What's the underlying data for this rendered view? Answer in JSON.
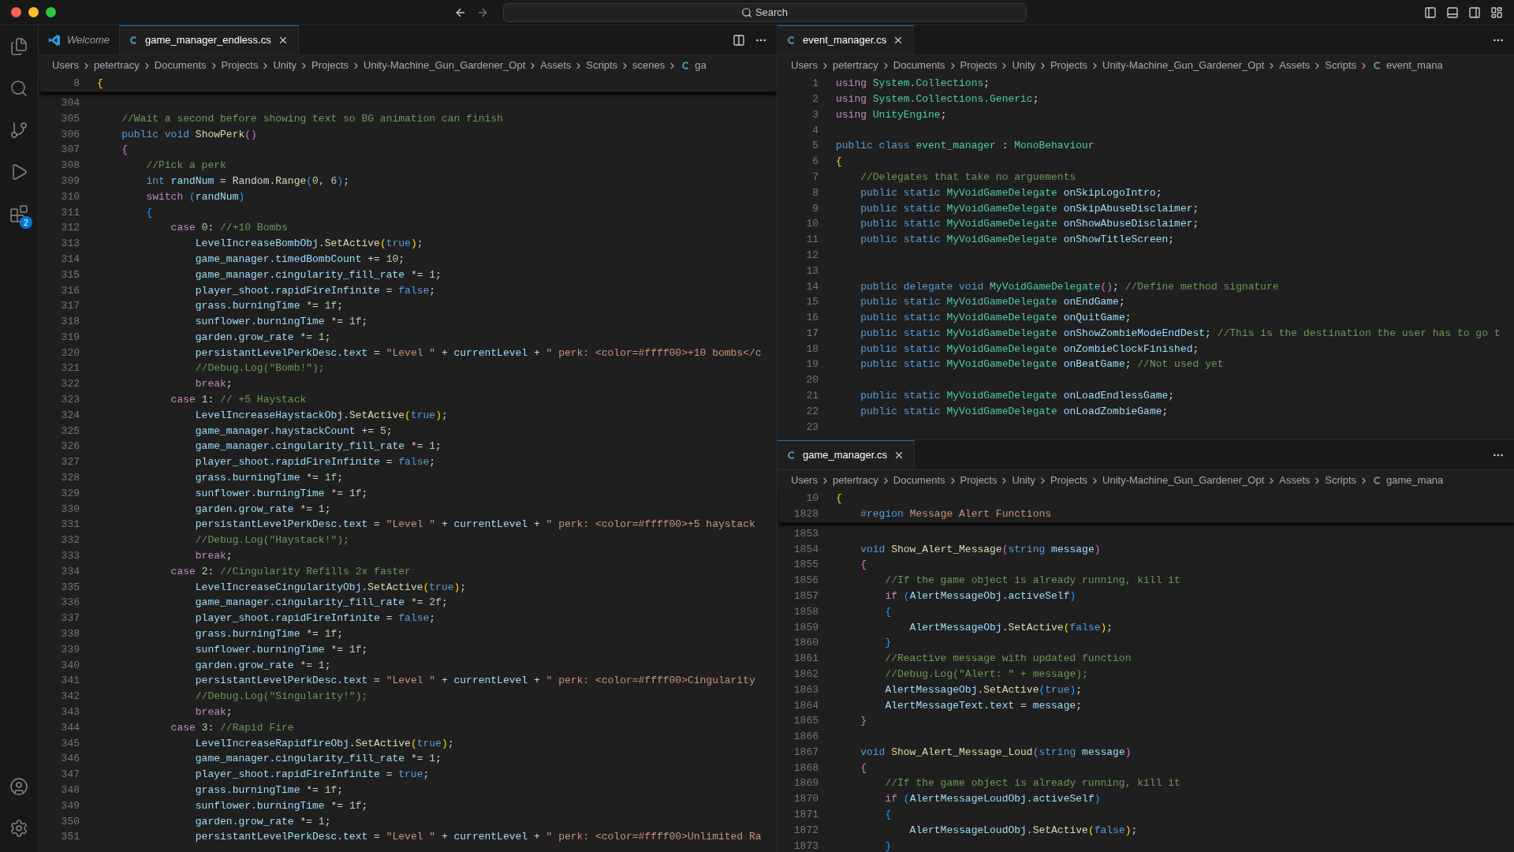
{
  "title_bar": {
    "command_center": {
      "label": "Search"
    }
  },
  "activity_bar": {
    "top": [
      {
        "kind": "files"
      },
      {
        "kind": "search"
      },
      {
        "kind": "source_control"
      },
      {
        "kind": "run"
      },
      {
        "kind": "extensions",
        "badge": "2"
      }
    ],
    "bottom": [
      {
        "kind": "account"
      },
      {
        "kind": "settings"
      }
    ]
  },
  "left_group": {
    "tabs": [
      {
        "label": "Welcome",
        "kind": "welcome",
        "selected": false,
        "preview": true
      },
      {
        "label": "game_manager_endless.cs",
        "kind": "csharp",
        "selected": true,
        "preview": false
      }
    ],
    "breadcrumbs": [
      "Users",
      "petertracy",
      "Documents",
      "Projects",
      "Unity",
      "Projects",
      "Unity-Machine_Gun_Gardener_Opt",
      "Assets",
      "Scripts",
      "scenes"
    ],
    "breadcrumb_file": "ga",
    "sticky_lines": [
      {
        "number": "8",
        "tokens": [
          {
            "kind": "p1",
            "text": "{"
          }
        ]
      }
    ],
    "lines": [
      {
        "number": "304"
      },
      {
        "number": "305",
        "tokens": [
          {
            "kind": "com",
            "text": "    //Wait a second before showing text so BG animation can finish"
          }
        ]
      },
      {
        "number": "306",
        "tokens": [
          {
            "kind": "kw",
            "text": "    public void "
          },
          {
            "kind": "fn",
            "text": "ShowPerk"
          },
          {
            "kind": "p2",
            "text": "()"
          }
        ]
      },
      {
        "number": "307",
        "tokens": [
          {
            "kind": "p2",
            "text": "    {"
          }
        ]
      },
      {
        "number": "308",
        "tokens": [
          {
            "kind": "com",
            "text": "        //Pick a perk"
          }
        ]
      },
      {
        "number": "309",
        "tokens": [
          {
            "kind": "kw",
            "text": "        int "
          },
          {
            "kind": "var",
            "text": "randNum"
          },
          {
            "kind": "txt",
            "text": " = Random."
          },
          {
            "kind": "fn",
            "text": "Range"
          },
          {
            "kind": "p3",
            "text": "("
          },
          {
            "kind": "num",
            "text": "0"
          },
          {
            "kind": "txt",
            "text": ", "
          },
          {
            "kind": "num",
            "text": "6"
          },
          {
            "kind": "p3",
            "text": ")"
          },
          {
            "kind": "txt",
            "text": ";"
          }
        ]
      },
      {
        "number": "310",
        "tokens": [
          {
            "kind": "ctl",
            "text": "        switch "
          },
          {
            "kind": "p3",
            "text": "("
          },
          {
            "kind": "var",
            "text": "randNum"
          },
          {
            "kind": "p3",
            "text": ")"
          }
        ]
      },
      {
        "number": "311",
        "tokens": [
          {
            "kind": "p3",
            "text": "        {"
          }
        ]
      },
      {
        "number": "312",
        "tokens": [
          {
            "kind": "ctl",
            "text": "            case "
          },
          {
            "kind": "num",
            "text": "0"
          },
          {
            "kind": "txt",
            "text": ": "
          },
          {
            "kind": "com",
            "text": "//+10 Bombs"
          }
        ]
      },
      {
        "number": "313",
        "tokens": [
          {
            "kind": "var",
            "text": "                LevelIncreaseBombObj"
          },
          {
            "kind": "txt",
            "text": "."
          },
          {
            "kind": "fn",
            "text": "SetActive"
          },
          {
            "kind": "p1",
            "text": "("
          },
          {
            "kind": "kw",
            "text": "true"
          },
          {
            "kind": "p1",
            "text": ")"
          },
          {
            "kind": "txt",
            "text": ";"
          }
        ]
      },
      {
        "number": "314",
        "tokens": [
          {
            "kind": "var",
            "text": "                game_manager.timedBombCount"
          },
          {
            "kind": "txt",
            "text": " += "
          },
          {
            "kind": "num",
            "text": "10"
          },
          {
            "kind": "txt",
            "text": ";"
          }
        ]
      },
      {
        "number": "315",
        "tokens": [
          {
            "kind": "var",
            "text": "                game_manager.cingularity_fill_rate"
          },
          {
            "kind": "txt",
            "text": " *= "
          },
          {
            "kind": "num",
            "text": "1"
          },
          {
            "kind": "txt",
            "text": ";"
          }
        ]
      },
      {
        "number": "316",
        "tokens": [
          {
            "kind": "var",
            "text": "                player_shoot.rapidFireInfinite"
          },
          {
            "kind": "txt",
            "text": " = "
          },
          {
            "kind": "kw",
            "text": "false"
          },
          {
            "kind": "txt",
            "text": ";"
          }
        ]
      },
      {
        "number": "317",
        "tokens": [
          {
            "kind": "var",
            "text": "                grass.burningTime"
          },
          {
            "kind": "txt",
            "text": " *= "
          },
          {
            "kind": "num",
            "text": "1f"
          },
          {
            "kind": "txt",
            "text": ";"
          }
        ]
      },
      {
        "number": "318",
        "tokens": [
          {
            "kind": "var",
            "text": "                sunflower.burningTime"
          },
          {
            "kind": "txt",
            "text": " *= "
          },
          {
            "kind": "num",
            "text": "1f"
          },
          {
            "kind": "txt",
            "text": ";"
          }
        ]
      },
      {
        "number": "319",
        "tokens": [
          {
            "kind": "var",
            "text": "                garden.grow_rate"
          },
          {
            "kind": "txt",
            "text": " *= "
          },
          {
            "kind": "num",
            "text": "1"
          },
          {
            "kind": "txt",
            "text": ";"
          }
        ]
      },
      {
        "number": "320",
        "tokens": [
          {
            "kind": "var",
            "text": "                persistantLevelPerkDesc.text"
          },
          {
            "kind": "txt",
            "text": " = "
          },
          {
            "kind": "str",
            "text": "\"Level \""
          },
          {
            "kind": "txt",
            "text": " + "
          },
          {
            "kind": "var",
            "text": "currentLevel"
          },
          {
            "kind": "txt",
            "text": " + "
          },
          {
            "kind": "str",
            "text": "\" perk: <color=#ffff00>+10 bombs</c"
          }
        ]
      },
      {
        "number": "321",
        "tokens": [
          {
            "kind": "com",
            "text": "                //Debug.Log(\"Bomb!\");"
          }
        ]
      },
      {
        "number": "322",
        "tokens": [
          {
            "kind": "ctl",
            "text": "                break"
          },
          {
            "kind": "txt",
            "text": ";"
          }
        ]
      },
      {
        "number": "323",
        "tokens": [
          {
            "kind": "ctl",
            "text": "            case "
          },
          {
            "kind": "num",
            "text": "1"
          },
          {
            "kind": "txt",
            "text": ": "
          },
          {
            "kind": "com",
            "text": "// +5 Haystack"
          }
        ]
      },
      {
        "number": "324",
        "tokens": [
          {
            "kind": "var",
            "text": "                LevelIncreaseHaystackObj"
          },
          {
            "kind": "txt",
            "text": "."
          },
          {
            "kind": "fn",
            "text": "SetActive"
          },
          {
            "kind": "p1",
            "text": "("
          },
          {
            "kind": "kw",
            "text": "true"
          },
          {
            "kind": "p1",
            "text": ")"
          },
          {
            "kind": "txt",
            "text": ";"
          }
        ]
      },
      {
        "number": "325",
        "tokens": [
          {
            "kind": "var",
            "text": "                game_manager.haystackCount"
          },
          {
            "kind": "txt",
            "text": " += "
          },
          {
            "kind": "num",
            "text": "5"
          },
          {
            "kind": "txt",
            "text": ";"
          }
        ]
      },
      {
        "number": "326",
        "tokens": [
          {
            "kind": "var",
            "text": "                game_manager.cingularity_fill_rate"
          },
          {
            "kind": "txt",
            "text": " *= "
          },
          {
            "kind": "num",
            "text": "1"
          },
          {
            "kind": "txt",
            "text": ";"
          }
        ]
      },
      {
        "number": "327",
        "tokens": [
          {
            "kind": "var",
            "text": "                player_shoot.rapidFireInfinite"
          },
          {
            "kind": "txt",
            "text": " = "
          },
          {
            "kind": "kw",
            "text": "false"
          },
          {
            "kind": "txt",
            "text": ";"
          }
        ]
      },
      {
        "number": "328",
        "tokens": [
          {
            "kind": "var",
            "text": "                grass.burningTime"
          },
          {
            "kind": "txt",
            "text": " *= "
          },
          {
            "kind": "num",
            "text": "1f"
          },
          {
            "kind": "txt",
            "text": ";"
          }
        ]
      },
      {
        "number": "329",
        "tokens": [
          {
            "kind": "var",
            "text": "                sunflower.burningTime"
          },
          {
            "kind": "txt",
            "text": " *= "
          },
          {
            "kind": "num",
            "text": "1f"
          },
          {
            "kind": "txt",
            "text": ";"
          }
        ]
      },
      {
        "number": "330",
        "tokens": [
          {
            "kind": "var",
            "text": "                garden.grow_rate"
          },
          {
            "kind": "txt",
            "text": " *= "
          },
          {
            "kind": "num",
            "text": "1"
          },
          {
            "kind": "txt",
            "text": ";"
          }
        ]
      },
      {
        "number": "331",
        "tokens": [
          {
            "kind": "var",
            "text": "                persistantLevelPerkDesc.text"
          },
          {
            "kind": "txt",
            "text": " = "
          },
          {
            "kind": "str",
            "text": "\"Level \""
          },
          {
            "kind": "txt",
            "text": " + "
          },
          {
            "kind": "var",
            "text": "currentLevel"
          },
          {
            "kind": "txt",
            "text": " + "
          },
          {
            "kind": "str",
            "text": "\" perk: <color=#ffff00>+5 haystack"
          }
        ]
      },
      {
        "number": "332",
        "tokens": [
          {
            "kind": "com",
            "text": "                //Debug.Log(\"Haystack!\");"
          }
        ]
      },
      {
        "number": "333",
        "tokens": [
          {
            "kind": "ctl",
            "text": "                break"
          },
          {
            "kind": "txt",
            "text": ";"
          }
        ]
      },
      {
        "number": "334",
        "tokens": [
          {
            "kind": "ctl",
            "text": "            case "
          },
          {
            "kind": "num",
            "text": "2"
          },
          {
            "kind": "txt",
            "text": ": "
          },
          {
            "kind": "com",
            "text": "//Cingularity Refills 2x faster"
          }
        ]
      },
      {
        "number": "335",
        "tokens": [
          {
            "kind": "var",
            "text": "                LevelIncreaseCingularityObj"
          },
          {
            "kind": "txt",
            "text": "."
          },
          {
            "kind": "fn",
            "text": "SetActive"
          },
          {
            "kind": "p1",
            "text": "("
          },
          {
            "kind": "kw",
            "text": "true"
          },
          {
            "kind": "p1",
            "text": ")"
          },
          {
            "kind": "txt",
            "text": ";"
          }
        ]
      },
      {
        "number": "336",
        "tokens": [
          {
            "kind": "var",
            "text": "                game_manager.cingularity_fill_rate"
          },
          {
            "kind": "txt",
            "text": " *= "
          },
          {
            "kind": "num",
            "text": "2f"
          },
          {
            "kind": "txt",
            "text": ";"
          }
        ]
      },
      {
        "number": "337",
        "tokens": [
          {
            "kind": "var",
            "text": "                player_shoot.rapidFireInfinite"
          },
          {
            "kind": "txt",
            "text": " = "
          },
          {
            "kind": "kw",
            "text": "false"
          },
          {
            "kind": "txt",
            "text": ";"
          }
        ]
      },
      {
        "number": "338",
        "tokens": [
          {
            "kind": "var",
            "text": "                grass.burningTime"
          },
          {
            "kind": "txt",
            "text": " *= "
          },
          {
            "kind": "num",
            "text": "1f"
          },
          {
            "kind": "txt",
            "text": ";"
          }
        ]
      },
      {
        "number": "339",
        "tokens": [
          {
            "kind": "var",
            "text": "                sunflower.burningTime"
          },
          {
            "kind": "txt",
            "text": " *= "
          },
          {
            "kind": "num",
            "text": "1f"
          },
          {
            "kind": "txt",
            "text": ";"
          }
        ]
      },
      {
        "number": "340",
        "tokens": [
          {
            "kind": "var",
            "text": "                garden.grow_rate"
          },
          {
            "kind": "txt",
            "text": " *= "
          },
          {
            "kind": "num",
            "text": "1"
          },
          {
            "kind": "txt",
            "text": ";"
          }
        ]
      },
      {
        "number": "341",
        "tokens": [
          {
            "kind": "var",
            "text": "                persistantLevelPerkDesc.text"
          },
          {
            "kind": "txt",
            "text": " = "
          },
          {
            "kind": "str",
            "text": "\"Level \""
          },
          {
            "kind": "txt",
            "text": " + "
          },
          {
            "kind": "var",
            "text": "currentLevel"
          },
          {
            "kind": "txt",
            "text": " + "
          },
          {
            "kind": "str",
            "text": "\" perk: <color=#ffff00>Cingularity"
          }
        ]
      },
      {
        "number": "342",
        "tokens": [
          {
            "kind": "com",
            "text": "                //Debug.Log(\"Singularity!\");"
          }
        ]
      },
      {
        "number": "343",
        "tokens": [
          {
            "kind": "ctl",
            "text": "                break"
          },
          {
            "kind": "txt",
            "text": ";"
          }
        ]
      },
      {
        "number": "344",
        "tokens": [
          {
            "kind": "ctl",
            "text": "            case "
          },
          {
            "kind": "num",
            "text": "3"
          },
          {
            "kind": "txt",
            "text": ": "
          },
          {
            "kind": "com",
            "text": "//Rapid Fire"
          }
        ]
      },
      {
        "number": "345",
        "tokens": [
          {
            "kind": "var",
            "text": "                LevelIncreaseRapidfireObj"
          },
          {
            "kind": "txt",
            "text": "."
          },
          {
            "kind": "fn",
            "text": "SetActive"
          },
          {
            "kind": "p1",
            "text": "("
          },
          {
            "kind": "kw",
            "text": "true"
          },
          {
            "kind": "p1",
            "text": ")"
          },
          {
            "kind": "txt",
            "text": ";"
          }
        ]
      },
      {
        "number": "346",
        "tokens": [
          {
            "kind": "var",
            "text": "                game_manager.cingularity_fill_rate"
          },
          {
            "kind": "txt",
            "text": " *= "
          },
          {
            "kind": "num",
            "text": "1"
          },
          {
            "kind": "txt",
            "text": ";"
          }
        ]
      },
      {
        "number": "347",
        "tokens": [
          {
            "kind": "var",
            "text": "                player_shoot.rapidFireInfinite"
          },
          {
            "kind": "txt",
            "text": " = "
          },
          {
            "kind": "kw",
            "text": "true"
          },
          {
            "kind": "txt",
            "text": ";"
          }
        ]
      },
      {
        "number": "348",
        "tokens": [
          {
            "kind": "var",
            "text": "                grass.burningTime"
          },
          {
            "kind": "txt",
            "text": " *= "
          },
          {
            "kind": "num",
            "text": "1f"
          },
          {
            "kind": "txt",
            "text": ";"
          }
        ]
      },
      {
        "number": "349",
        "tokens": [
          {
            "kind": "var",
            "text": "                sunflower.burningTime"
          },
          {
            "kind": "txt",
            "text": " *= "
          },
          {
            "kind": "num",
            "text": "1f"
          },
          {
            "kind": "txt",
            "text": ";"
          }
        ]
      },
      {
        "number": "350",
        "tokens": [
          {
            "kind": "var",
            "text": "                garden.grow_rate"
          },
          {
            "kind": "txt",
            "text": " *= "
          },
          {
            "kind": "num",
            "text": "1"
          },
          {
            "kind": "txt",
            "text": ";"
          }
        ]
      },
      {
        "number": "351",
        "tokens": [
          {
            "kind": "var",
            "text": "                persistantLevelPerkDesc.text"
          },
          {
            "kind": "txt",
            "text": " = "
          },
          {
            "kind": "str",
            "text": "\"Level \""
          },
          {
            "kind": "txt",
            "text": " + "
          },
          {
            "kind": "var",
            "text": "currentLevel"
          },
          {
            "kind": "txt",
            "text": " + "
          },
          {
            "kind": "str",
            "text": "\" perk: <color=#ffff00>Unlimited Ra"
          }
        ]
      }
    ]
  },
  "right_panes": [
    {
      "tabs": [
        {
          "label": "event_manager.cs",
          "kind": "csharp",
          "selected": true,
          "preview": false
        }
      ],
      "breadcrumbs": [
        "Users",
        "petertracy",
        "Documents",
        "Projects",
        "Unity",
        "Projects",
        "Unity-Machine_Gun_Gardener_Opt",
        "Assets",
        "Scripts"
      ],
      "breadcrumb_file": "event_mana",
      "lines": [
        {
          "number": "1",
          "tokens": [
            {
              "kind": "ctl",
              "text": "using "
            },
            {
              "kind": "type",
              "text": "System.Collections"
            },
            {
              "kind": "txt",
              "text": ";"
            }
          ]
        },
        {
          "number": "2",
          "tokens": [
            {
              "kind": "ctl",
              "text": "using "
            },
            {
              "kind": "type",
              "text": "System.Collections.Generic"
            },
            {
              "kind": "txt",
              "text": ";"
            }
          ]
        },
        {
          "number": "3",
          "tokens": [
            {
              "kind": "ctl",
              "text": "using "
            },
            {
              "kind": "type",
              "text": "UnityEngine"
            },
            {
              "kind": "txt",
              "text": ";"
            }
          ]
        },
        {
          "number": "4"
        },
        {
          "number": "5",
          "tokens": [
            {
              "kind": "kw",
              "text": "public class "
            },
            {
              "kind": "type",
              "text": "event_manager"
            },
            {
              "kind": "txt",
              "text": " : "
            },
            {
              "kind": "type",
              "text": "MonoBehaviour"
            }
          ]
        },
        {
          "number": "6",
          "tokens": [
            {
              "kind": "p1",
              "text": "{"
            }
          ]
        },
        {
          "number": "7",
          "tokens": [
            {
              "kind": "com",
              "text": "    //Delegates that take no arguements"
            }
          ]
        },
        {
          "number": "8",
          "tokens": [
            {
              "kind": "kw",
              "text": "    public static "
            },
            {
              "kind": "type",
              "text": "MyVoidGameDelegate"
            },
            {
              "kind": "var",
              "text": " onSkipLogoIntro"
            },
            {
              "kind": "txt",
              "text": ";"
            }
          ]
        },
        {
          "number": "9",
          "tokens": [
            {
              "kind": "kw",
              "text": "    public static "
            },
            {
              "kind": "type",
              "text": "MyVoidGameDelegate"
            },
            {
              "kind": "var",
              "text": " onSkipAbuseDisclaimer"
            },
            {
              "kind": "txt",
              "text": ";"
            }
          ]
        },
        {
          "number": "10",
          "tokens": [
            {
              "kind": "kw",
              "text": "    public static "
            },
            {
              "kind": "type",
              "text": "MyVoidGameDelegate"
            },
            {
              "kind": "var",
              "text": " onShowAbuseDisclaimer"
            },
            {
              "kind": "txt",
              "text": ";"
            }
          ]
        },
        {
          "number": "11",
          "tokens": [
            {
              "kind": "kw",
              "text": "    public static "
            },
            {
              "kind": "type",
              "text": "MyVoidGameDelegate"
            },
            {
              "kind": "var",
              "text": " onShowTitleScreen"
            },
            {
              "kind": "txt",
              "text": ";"
            }
          ]
        },
        {
          "number": "12"
        },
        {
          "number": "13"
        },
        {
          "number": "14",
          "tokens": [
            {
              "kind": "kw",
              "text": "    public delegate void "
            },
            {
              "kind": "type",
              "text": "MyVoidGameDelegate"
            },
            {
              "kind": "p2",
              "text": "()"
            },
            {
              "kind": "txt",
              "text": "; "
            },
            {
              "kind": "com",
              "text": "//Define method signature"
            }
          ]
        },
        {
          "number": "15",
          "tokens": [
            {
              "kind": "kw",
              "text": "    public static "
            },
            {
              "kind": "type",
              "text": "MyVoidGameDelegate"
            },
            {
              "kind": "var",
              "text": " onEndGame"
            },
            {
              "kind": "txt",
              "text": ";"
            }
          ]
        },
        {
          "number": "16",
          "tokens": [
            {
              "kind": "kw",
              "text": "    public static "
            },
            {
              "kind": "type",
              "text": "MyVoidGameDelegate"
            },
            {
              "kind": "var",
              "text": " onQuitGame"
            },
            {
              "kind": "txt",
              "text": ";"
            }
          ]
        },
        {
          "number": "17",
          "tokens": [
            {
              "kind": "kw",
              "text": "    public static "
            },
            {
              "kind": "type",
              "text": "MyVoidGameDelegate"
            },
            {
              "kind": "var",
              "text": " onShowZombieModeEndDest"
            },
            {
              "kind": "txt",
              "text": "; "
            },
            {
              "kind": "com",
              "text": "//This is the destination the user has to go t"
            }
          ]
        },
        {
          "number": "18",
          "tokens": [
            {
              "kind": "kw",
              "text": "    public static "
            },
            {
              "kind": "type",
              "text": "MyVoidGameDelegate"
            },
            {
              "kind": "var",
              "text": " onZombieClockFinished"
            },
            {
              "kind": "txt",
              "text": ";"
            }
          ]
        },
        {
          "number": "19",
          "tokens": [
            {
              "kind": "kw",
              "text": "    public static "
            },
            {
              "kind": "type",
              "text": "MyVoidGameDelegate"
            },
            {
              "kind": "var",
              "text": " onBeatGame"
            },
            {
              "kind": "txt",
              "text": "; "
            },
            {
              "kind": "com",
              "text": "//Not used yet"
            }
          ]
        },
        {
          "number": "20"
        },
        {
          "number": "21",
          "tokens": [
            {
              "kind": "kw",
              "text": "    public static "
            },
            {
              "kind": "type",
              "text": "MyVoidGameDelegate"
            },
            {
              "kind": "var",
              "text": " onLoadEndlessGame"
            },
            {
              "kind": "txt",
              "text": ";"
            }
          ]
        },
        {
          "number": "22",
          "tokens": [
            {
              "kind": "kw",
              "text": "    public static "
            },
            {
              "kind": "type",
              "text": "MyVoidGameDelegate"
            },
            {
              "kind": "var",
              "text": " onLoadZombieGame"
            },
            {
              "kind": "txt",
              "text": ";"
            }
          ]
        },
        {
          "number": "23"
        }
      ]
    },
    {
      "tabs": [
        {
          "label": "game_manager.cs",
          "kind": "csharp",
          "selected": true,
          "preview": false
        }
      ],
      "breadcrumbs": [
        "Users",
        "petertracy",
        "Documents",
        "Projects",
        "Unity",
        "Projects",
        "Unity-Machine_Gun_Gardener_Opt",
        "Assets",
        "Scripts"
      ],
      "breadcrumb_file": "game_mana",
      "sticky_lines": [
        {
          "number": "10",
          "tokens": [
            {
              "kind": "p1",
              "text": "{"
            }
          ]
        },
        {
          "number": "1828",
          "tokens": [
            {
              "kind": "kw",
              "text": "    #region "
            },
            {
              "kind": "str",
              "text": "Message Alert Functions"
            }
          ]
        }
      ],
      "lines": [
        {
          "number": "1853"
        },
        {
          "number": "1854",
          "tokens": [
            {
              "kind": "kw",
              "text": "    void "
            },
            {
              "kind": "fn",
              "text": "Show_Alert_Message"
            },
            {
              "kind": "p2",
              "text": "("
            },
            {
              "kind": "kw",
              "text": "string "
            },
            {
              "kind": "var",
              "text": "message"
            },
            {
              "kind": "p2",
              "text": ")"
            }
          ]
        },
        {
          "number": "1855",
          "tokens": [
            {
              "kind": "p2",
              "text": "    {"
            }
          ]
        },
        {
          "number": "1856",
          "tokens": [
            {
              "kind": "com",
              "text": "        //If the game object is already running, kill it"
            }
          ]
        },
        {
          "number": "1857",
          "tokens": [
            {
              "kind": "ctl",
              "text": "        if "
            },
            {
              "kind": "p3",
              "text": "("
            },
            {
              "kind": "var",
              "text": "AlertMessageObj.activeSelf"
            },
            {
              "kind": "p3",
              "text": ")"
            }
          ]
        },
        {
          "number": "1858",
          "tokens": [
            {
              "kind": "p3",
              "text": "        {"
            }
          ]
        },
        {
          "number": "1859",
          "tokens": [
            {
              "kind": "var",
              "text": "            AlertMessageObj"
            },
            {
              "kind": "txt",
              "text": "."
            },
            {
              "kind": "fn",
              "text": "SetActive"
            },
            {
              "kind": "p1",
              "text": "("
            },
            {
              "kind": "kw",
              "text": "false"
            },
            {
              "kind": "p1",
              "text": ")"
            },
            {
              "kind": "txt",
              "text": ";"
            }
          ]
        },
        {
          "number": "1860",
          "tokens": [
            {
              "kind": "p3",
              "text": "        }"
            }
          ]
        },
        {
          "number": "1861",
          "tokens": [
            {
              "kind": "com",
              "text": "        //Reactive message with updated function"
            }
          ]
        },
        {
          "number": "1862",
          "tokens": [
            {
              "kind": "com",
              "text": "        //Debug.Log(\"Alert: \" + message);"
            }
          ]
        },
        {
          "number": "1863",
          "tokens": [
            {
              "kind": "var",
              "text": "        AlertMessageObj"
            },
            {
              "kind": "txt",
              "text": "."
            },
            {
              "kind": "fn",
              "text": "SetActive"
            },
            {
              "kind": "p3",
              "text": "("
            },
            {
              "kind": "kw",
              "text": "true"
            },
            {
              "kind": "p3",
              "text": ")"
            },
            {
              "kind": "txt",
              "text": ";"
            }
          ]
        },
        {
          "number": "1864",
          "tokens": [
            {
              "kind": "var",
              "text": "        AlertMessageText.text"
            },
            {
              "kind": "txt",
              "text": " = "
            },
            {
              "kind": "var",
              "text": "message"
            },
            {
              "kind": "txt",
              "text": ";"
            }
          ]
        },
        {
          "number": "1865",
          "tokens": [
            {
              "kind": "p2",
              "text": "    }"
            }
          ]
        },
        {
          "number": "1866"
        },
        {
          "number": "1867",
          "tokens": [
            {
              "kind": "kw",
              "text": "    void "
            },
            {
              "kind": "fn",
              "text": "Show_Alert_Message_Loud"
            },
            {
              "kind": "p2",
              "text": "("
            },
            {
              "kind": "kw",
              "text": "string "
            },
            {
              "kind": "var",
              "text": "message"
            },
            {
              "kind": "p2",
              "text": ")"
            }
          ]
        },
        {
          "number": "1868",
          "tokens": [
            {
              "kind": "p2",
              "text": "    {"
            }
          ]
        },
        {
          "number": "1869",
          "tokens": [
            {
              "kind": "com",
              "text": "        //If the game object is already running, kill it"
            }
          ]
        },
        {
          "number": "1870",
          "tokens": [
            {
              "kind": "ctl",
              "text": "        if "
            },
            {
              "kind": "p3",
              "text": "("
            },
            {
              "kind": "var",
              "text": "AlertMessageLoudObj.activeSelf"
            },
            {
              "kind": "p3",
              "text": ")"
            }
          ]
        },
        {
          "number": "1871",
          "tokens": [
            {
              "kind": "p3",
              "text": "        {"
            }
          ]
        },
        {
          "number": "1872",
          "tokens": [
            {
              "kind": "var",
              "text": "            AlertMessageLoudObj"
            },
            {
              "kind": "txt",
              "text": "."
            },
            {
              "kind": "fn",
              "text": "SetActive"
            },
            {
              "kind": "p1",
              "text": "("
            },
            {
              "kind": "kw",
              "text": "false"
            },
            {
              "kind": "p1",
              "text": ")"
            },
            {
              "kind": "txt",
              "text": ";"
            }
          ]
        },
        {
          "number": "1873",
          "tokens": [
            {
              "kind": "p3",
              "text": "        }"
            }
          ]
        }
      ]
    }
  ]
}
